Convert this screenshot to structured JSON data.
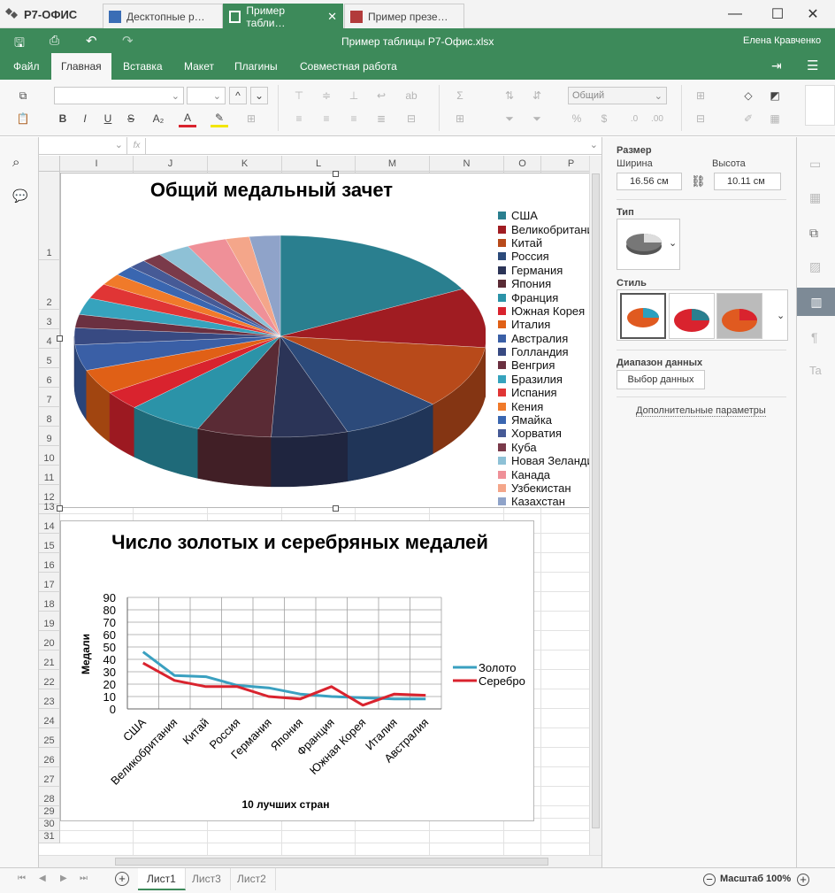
{
  "window": {
    "logo": "Р7-ОФИС",
    "tabs": [
      {
        "label": "Десктопные р…",
        "icon": "document-icon"
      },
      {
        "label": "Пример табли…",
        "icon": "spreadsheet-icon"
      },
      {
        "label": "Пример презе…",
        "icon": "presentation-icon"
      }
    ]
  },
  "app": {
    "title": "Пример таблицы Р7-Офис.xlsx",
    "user": "Елена Кравченко",
    "menu_tabs": [
      "Файл",
      "Главная",
      "Вставка",
      "Макет",
      "Плагины",
      "Совместная работа"
    ],
    "active_tab": "Главная"
  },
  "toolbar": {
    "number_format": "Общий"
  },
  "grid": {
    "columns": [
      "I",
      "J",
      "K",
      "L",
      "M",
      "N",
      "O",
      "P"
    ],
    "rows": [
      "1",
      "2",
      "3",
      "4",
      "5",
      "6",
      "7",
      "8",
      "9",
      "10",
      "11",
      "12",
      "13",
      "14",
      "15",
      "16",
      "17",
      "18",
      "19",
      "20",
      "21",
      "22",
      "23",
      "24",
      "25",
      "26",
      "27",
      "28",
      "29",
      "30",
      "31"
    ]
  },
  "chart_data": [
    {
      "type": "pie",
      "title": "Общий медальный зачет",
      "categories": [
        "США",
        "Великобритания",
        "Китай",
        "Россия",
        "Германия",
        "Япония",
        "Франция",
        "Южная Корея",
        "Италия",
        "Австралия",
        "Голландия",
        "Венгрия",
        "Бразилия",
        "Испания",
        "Кения",
        "Ямайка",
        "Хорватия",
        "Куба",
        "Новая Зеландия",
        "Канада",
        "Узбекистан",
        "Казахстан"
      ],
      "legend_visible": [
        "США",
        "Великобритани",
        "Китай",
        "Россия",
        "Германия",
        "Япония",
        "Франция",
        "Южная Корея",
        "Италия",
        "Австралия",
        "Голландия",
        "Венгрия",
        "Бразилия",
        "Испания",
        "Кения",
        "Ямайка",
        "Хорватия",
        "Куба",
        "Новая Зеланди",
        "Канада",
        "Узбекистан",
        "Казахстан"
      ],
      "values": [
        121,
        67,
        70,
        56,
        42,
        41,
        42,
        21,
        28,
        29,
        19,
        15,
        19,
        17,
        13,
        11,
        10,
        11,
        18,
        22,
        13,
        17
      ],
      "colors": [
        "#2a7f8f",
        "#a01c22",
        "#b84a1a",
        "#2c4a7a",
        "#2b3457",
        "#5a2b35",
        "#2b93a8",
        "#d9232e",
        "#e06016",
        "#3a5fa6",
        "#384a82",
        "#6b3040",
        "#36a3bd",
        "#e03535",
        "#f07a2a",
        "#3a66b0",
        "#465a96",
        "#7a3a4a",
        "#8ec1d6",
        "#ef9098",
        "#f4a68a",
        "#8fa3c9"
      ],
      "legend_position": "right"
    },
    {
      "type": "line",
      "title": "Число золотых и серебряных медалей",
      "xlabel": "10 лучших стран",
      "ylabel": "Медали",
      "categories": [
        "США",
        "Великобритания",
        "Китай",
        "Россия",
        "Германия",
        "Япония",
        "Франция",
        "Южная Корея",
        "Италия",
        "Австралия"
      ],
      "series": [
        {
          "name": "Золото",
          "values": [
            46,
            27,
            26,
            19,
            17,
            12,
            10,
            9,
            8,
            8
          ],
          "color": "#3aa0c0"
        },
        {
          "name": "Серебро",
          "values": [
            37,
            23,
            18,
            18,
            10,
            8,
            18,
            3,
            12,
            11
          ],
          "color": "#d9232e"
        }
      ],
      "ylim": [
        0,
        90
      ],
      "yticks": [
        0,
        10,
        20,
        30,
        40,
        50,
        60,
        70,
        80,
        90
      ],
      "legend_position": "right",
      "grid": true
    }
  ],
  "panel": {
    "size_label": "Размер",
    "width_label": "Ширина",
    "width_value": "16.56 см",
    "height_label": "Высота",
    "height_value": "10.11 см",
    "type_label": "Тип",
    "style_label": "Стиль",
    "range_label": "Диапазон данных",
    "range_button": "Выбор данных",
    "advanced_link": "Дополнительные параметры"
  },
  "status": {
    "sheets": [
      "Лист1",
      "Лист3",
      "Лист2"
    ],
    "active_sheet": "Лист1",
    "zoom": "Масштаб 100%"
  }
}
